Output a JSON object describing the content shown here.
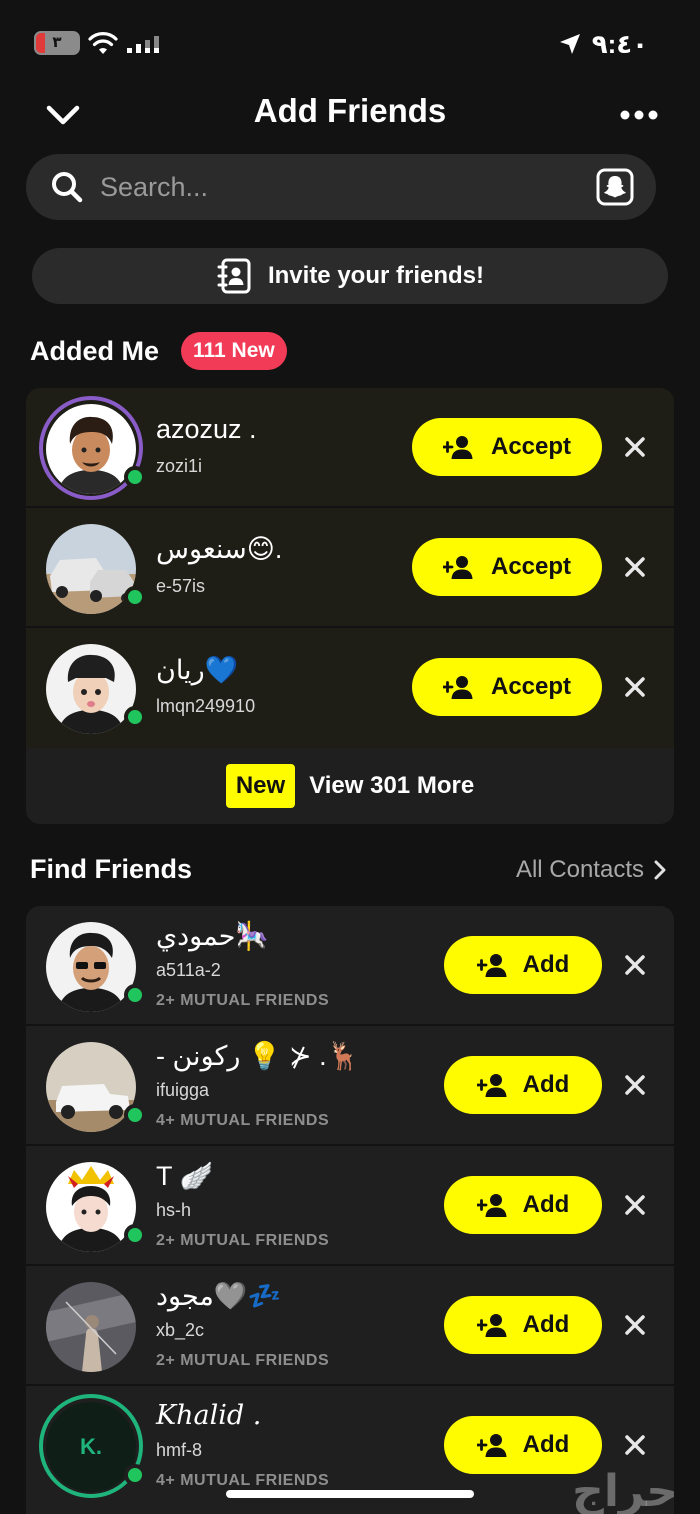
{
  "status_bar": {
    "battery_text": "٣",
    "time": "٩:٤٠"
  },
  "header": {
    "title": "Add Friends"
  },
  "search": {
    "placeholder": "Search..."
  },
  "invite": {
    "label": "Invite your friends!"
  },
  "added_me": {
    "title": "Added Me",
    "badge": "111 New",
    "accept_label": "Accept",
    "items": [
      {
        "name": "azozuz .",
        "username": "zozi1i"
      },
      {
        "name": "سنعوس😊.",
        "username": "e-57is"
      },
      {
        "name": "ريان💙",
        "username": "lmqn249910"
      }
    ],
    "view_more": {
      "badge": "New",
      "label": "View 301 More"
    }
  },
  "find_friends": {
    "title": "Find Friends",
    "all_contacts_label": "All Contacts",
    "add_label": "Add",
    "items": [
      {
        "name": "حمودي🎠",
        "username": "a511a-2",
        "mutual": "2+ MUTUAL FRIENDS"
      },
      {
        "name": "- ركونن 💡 ⊁ .🦌",
        "username": "ifuigga",
        "mutual": "4+ MUTUAL FRIENDS"
      },
      {
        "name": "T 🪽",
        "username": "hs-h",
        "mutual": "2+ MUTUAL FRIENDS"
      },
      {
        "name": "مجود🩶💤",
        "username": "xb_2c",
        "mutual": "2+ MUTUAL FRIENDS"
      },
      {
        "name": "Khalid .",
        "username": "hmf-8",
        "mutual": "4+ MUTUAL FRIENDS",
        "initial": "K."
      }
    ]
  },
  "watermark": "حراج",
  "colors": {
    "background": "#121212",
    "accent_yellow": "#fffc00",
    "badge_red": "#f23c57",
    "online_green": "#21c55d"
  }
}
